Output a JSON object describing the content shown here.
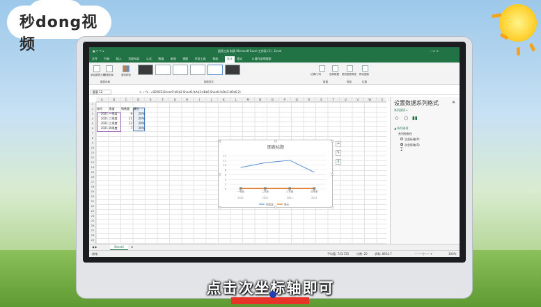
{
  "logo": {
    "text": "秒dong视频"
  },
  "excel": {
    "title": "图表工具    制表 Microsoft Excel 工作表 (2) - Excel",
    "tabs": [
      "文件",
      "开始",
      "插入",
      "页面布局",
      "公式",
      "数据",
      "审阅",
      "视图",
      "开发工具",
      "帮助",
      "设计",
      "格式"
    ],
    "active_tab_index": 10,
    "tell_me": "操作说明搜索",
    "ribbon_groups": [
      "图表布局",
      "图表样式",
      "数据",
      "类型",
      "位置"
    ],
    "ribbon_buttons": [
      "添加图表元素",
      "快速布局",
      "更改颜色",
      "切换行/列",
      "选择数据",
      "更改图表类型",
      "移动图表"
    ],
    "namebox": "图表 12",
    "formula": "=SERIES(Sheet1!$D$2,Sheet1!$A$3:$B$6,Sheet1!$D$3:$D$6,2)",
    "columns": [
      "A",
      "B",
      "C",
      "D",
      "E",
      "F",
      "G",
      "H",
      "I",
      "J",
      "K",
      "L",
      "M",
      "N",
      "O",
      "P",
      "Q",
      "R",
      "S",
      "T",
      "U",
      "V",
      "W",
      "X"
    ],
    "rows": [
      "1",
      "2",
      "3",
      "4",
      "5",
      "6",
      "7",
      "8",
      "9",
      "10",
      "11",
      "12",
      "13",
      "14",
      "15",
      "16",
      "17",
      "18",
      "19",
      "20",
      "21",
      "22",
      "23",
      "24",
      "25",
      "26",
      "27",
      "28",
      "29"
    ],
    "table": {
      "headers": [
        "年份",
        "季度",
        "销售量",
        "增长"
      ],
      "rows": [
        [
          "2021",
          "一季度",
          "9",
          "20%"
        ],
        [
          "2021",
          "二季度",
          "11",
          "20%"
        ],
        [
          "2021",
          "三季度",
          "12",
          "20%"
        ],
        [
          "2021",
          "四季度",
          "7",
          "20%"
        ]
      ]
    },
    "sheet_tab": "Sheet1",
    "status_left": "就绪",
    "status_right": [
      "平均值: 743.725",
      "计数: 20",
      "求和: 8924.7"
    ],
    "zoom": "100%"
  },
  "chart_data": {
    "type": "line",
    "title": "图表标题",
    "categories": [
      "一季度\n2021",
      "二季度\n2021",
      "三季度\n2021",
      "四季度\n2021"
    ],
    "category_top": [
      "一季度",
      "二季度",
      "三季度",
      "四季度"
    ],
    "category_bottom": [
      "2021",
      "2021",
      "2021",
      "2021"
    ],
    "series": [
      {
        "name": "销售量",
        "values": [
          9,
          11,
          12,
          7
        ],
        "color": "#5b8fd0"
      },
      {
        "name": "增长",
        "values": [
          0.2,
          0.2,
          0.2,
          0.2
        ],
        "color": "#e07b26"
      }
    ],
    "y_ticks": [
      "14",
      "12",
      "10",
      "8",
      "6",
      "4",
      "2",
      "0"
    ],
    "ylim": [
      0,
      14
    ],
    "grid": true,
    "legend": "bottom"
  },
  "format_panel": {
    "title": "设置数据系列格式",
    "subtitle": "系列选项 ▾",
    "section": "◢ 系列选项",
    "series_plot_on": "系列绘制在",
    "primary_axis": "主坐标轴(P)",
    "secondary_axis": "次坐标轴(S)"
  },
  "caption": "点击次坐标轴即可",
  "colors": {
    "excel_green": "#217346",
    "accent_blue": "#5b8fd0",
    "accent_orange": "#e07b26"
  }
}
